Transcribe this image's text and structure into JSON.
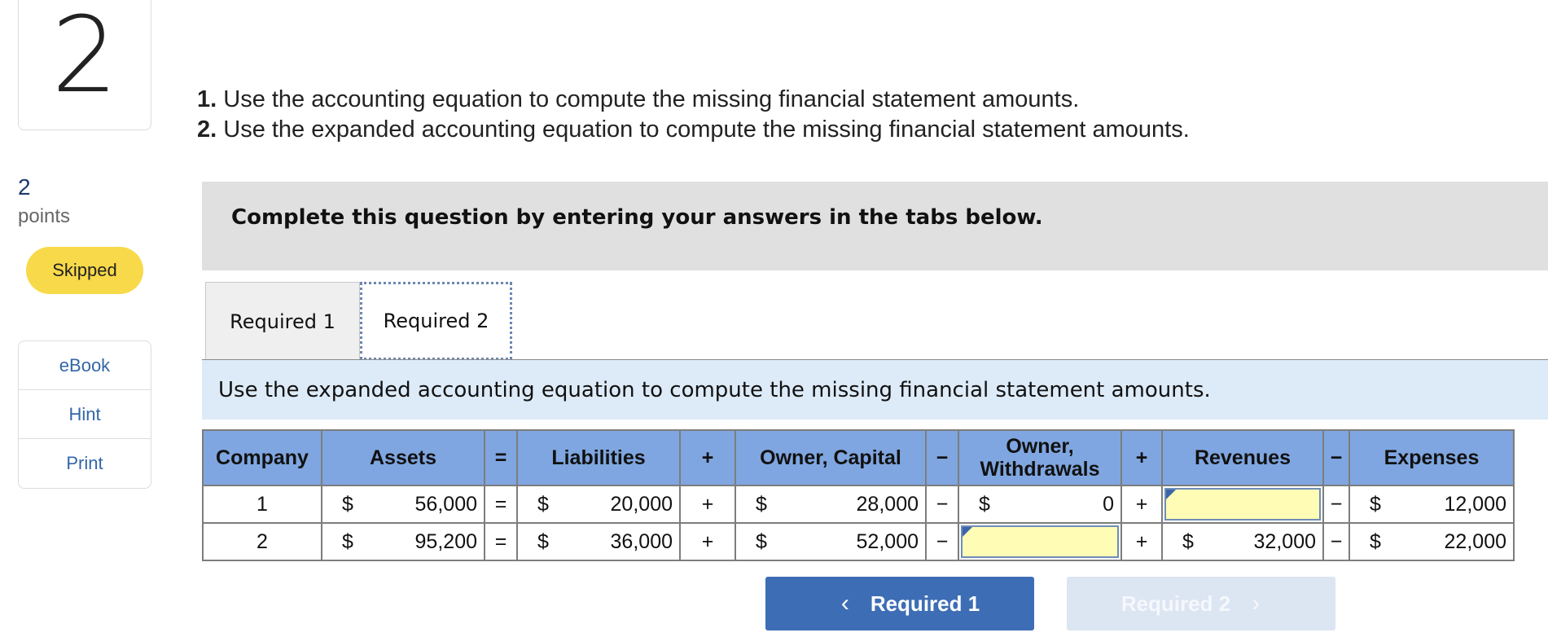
{
  "question": {
    "number": "2",
    "points_value": "2",
    "points_label": "points",
    "status": "Skipped"
  },
  "side_links": [
    "eBook",
    "Hint",
    "Print"
  ],
  "instructions": [
    {
      "num": "1.",
      "text": " Use the accounting equation to compute the missing financial statement amounts."
    },
    {
      "num": "2.",
      "text": " Use the expanded accounting equation to compute the missing financial statement amounts."
    }
  ],
  "banner": "Complete this question by entering your answers in the tabs below.",
  "tabs": [
    {
      "label": "Required 1",
      "active": false
    },
    {
      "label": "Required 2",
      "active": true
    }
  ],
  "subheader": "Use the expanded accounting equation to compute the missing financial statement amounts.",
  "table": {
    "headers": {
      "company": "Company",
      "assets": "Assets",
      "eq": "=",
      "liabilities": "Liabilities",
      "plus1": "+",
      "capital": "Owner, Capital",
      "minus1": "−",
      "withdrawals_line1": "Owner,",
      "withdrawals_line2": "Withdrawals",
      "plus2": "+",
      "revenues": "Revenues",
      "minus2": "−",
      "expenses": "Expenses"
    },
    "rows": [
      {
        "company": "1",
        "assets": "56,000",
        "eq": "=",
        "liabilities": "20,000",
        "plus1": "+",
        "capital": "28,000",
        "minus1": "−",
        "withdrawals": "0",
        "plus2": "+",
        "revenues": "",
        "minus2": "−",
        "expenses": "12,000"
      },
      {
        "company": "2",
        "assets": "95,200",
        "eq": "=",
        "liabilities": "36,000",
        "plus1": "+",
        "capital": "52,000",
        "minus1": "−",
        "withdrawals": "",
        "plus2": "+",
        "revenues": "32,000",
        "minus2": "−",
        "expenses": "22,000"
      }
    ],
    "currency": "$"
  },
  "nav": {
    "prev_label": "Required 1",
    "next_label": "Required 2",
    "prev_icon": "‹",
    "next_icon": "›"
  },
  "colors": {
    "header_bg": "#7fa6e0",
    "input_bg": "#fffcb5",
    "skipped_badge": "#f8d94a",
    "primary_button": "#3d6db5"
  }
}
